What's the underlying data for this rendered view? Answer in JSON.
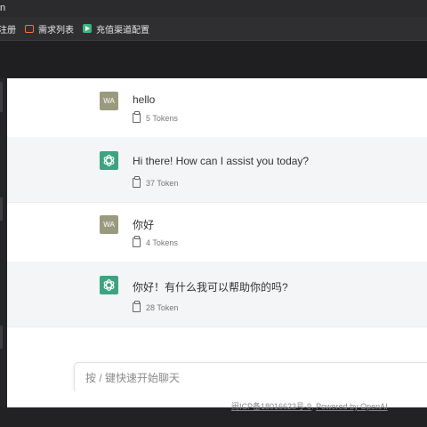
{
  "window": {
    "title_fragment": "n"
  },
  "bookmarks": [
    {
      "label": "注册",
      "icon": "partial-icon"
    },
    {
      "label": "需求列表",
      "icon": "bracket-icon"
    },
    {
      "label": "充值渠道配置",
      "icon": "play-icon"
    }
  ],
  "messages": [
    {
      "role": "user",
      "avatar": "WA",
      "text": "hello",
      "tokens": "5 Tokens"
    },
    {
      "role": "assistant",
      "avatar": "openai-logo",
      "text": "Hi there! How can I assist you today?",
      "tokens": "37 Token"
    },
    {
      "role": "user",
      "avatar": "WA",
      "text": "你好",
      "tokens": "4 Tokens"
    },
    {
      "role": "assistant",
      "avatar": "openai-logo",
      "text": "你好！有什么我可以帮助你的吗?",
      "tokens": "28 Token"
    }
  ],
  "input": {
    "placeholder": "按 / 键快速开始聊天",
    "value": ""
  },
  "footer": {
    "icp": "闽ICP备18016623号-9",
    "sep": ". ",
    "powered": "Powered by OpenAI"
  },
  "colors": {
    "user_avatar": "#9a9a7f",
    "bot_avatar": "#3ea37f"
  }
}
